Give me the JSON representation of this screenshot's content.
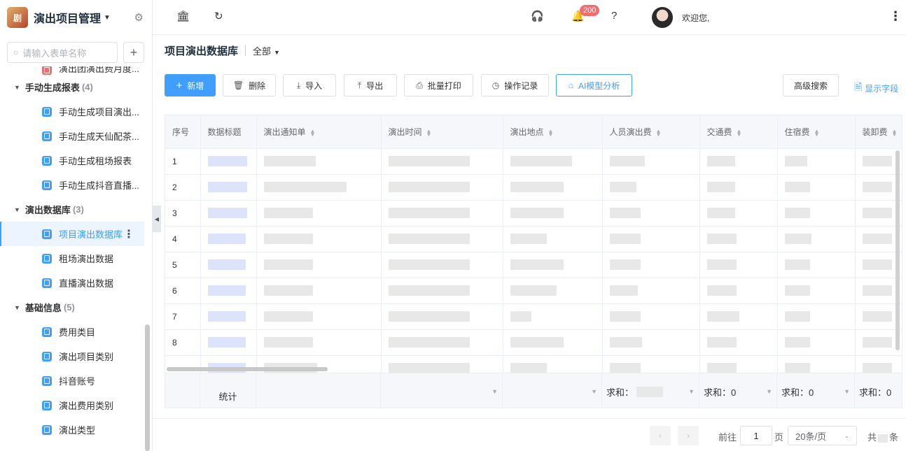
{
  "app": {
    "title": "演出项目管理",
    "logo_text": "剧"
  },
  "sidebar": {
    "search_placeholder": "请输入表单名称",
    "add_label": "+",
    "partial_item": "演出团演出费月度...",
    "groups": [
      {
        "label": "手动生成报表",
        "count": "(4)",
        "items": [
          "手动生成项目演出...",
          "手动生成天仙配茶...",
          "手动生成租场报表",
          "手动生成抖音直播..."
        ]
      },
      {
        "label": "演出数据库",
        "count": "(3)",
        "items": [
          "项目演出数据库",
          "租场演出数据",
          "直播演出数据"
        ]
      },
      {
        "label": "基础信息",
        "count": "(5)",
        "items": [
          "费用类目",
          "演出项目类别",
          "抖音账号",
          "演出费用类别",
          "演出类型"
        ]
      }
    ]
  },
  "topbar": {
    "badge": "200",
    "welcome": "欢迎您,"
  },
  "page": {
    "title": "项目演出数据库",
    "view": "全部"
  },
  "toolbar": {
    "new": "新增",
    "delete": "删除",
    "import": "导入",
    "export": "导出",
    "batch_print": "批量打印",
    "op_log": "操作记录",
    "ai": "AI模型分析",
    "advanced_search": "高级搜索",
    "show_fields": "显示字段"
  },
  "table": {
    "columns": [
      "序号",
      "数据标题",
      "演出通知单",
      "演出时间",
      "演出地点",
      "人员演出费",
      "交通费",
      "住宿费",
      "装卸费"
    ],
    "row_numbers": [
      "1",
      "2",
      "3",
      "4",
      "5",
      "6",
      "7",
      "8"
    ],
    "footer": {
      "label": "统计",
      "sum_person": "求和：",
      "sum_traffic": "求和：0",
      "sum_lodging": "求和：0",
      "sum_loading": "求和：0"
    }
  },
  "pagination": {
    "goto": "前往",
    "page": "1",
    "page_unit": "页",
    "page_size": "20条/页",
    "total_prefix": "共",
    "total_suffix": "条"
  },
  "colors": {
    "primary": "#409eff",
    "badge": "#f56c6c"
  }
}
